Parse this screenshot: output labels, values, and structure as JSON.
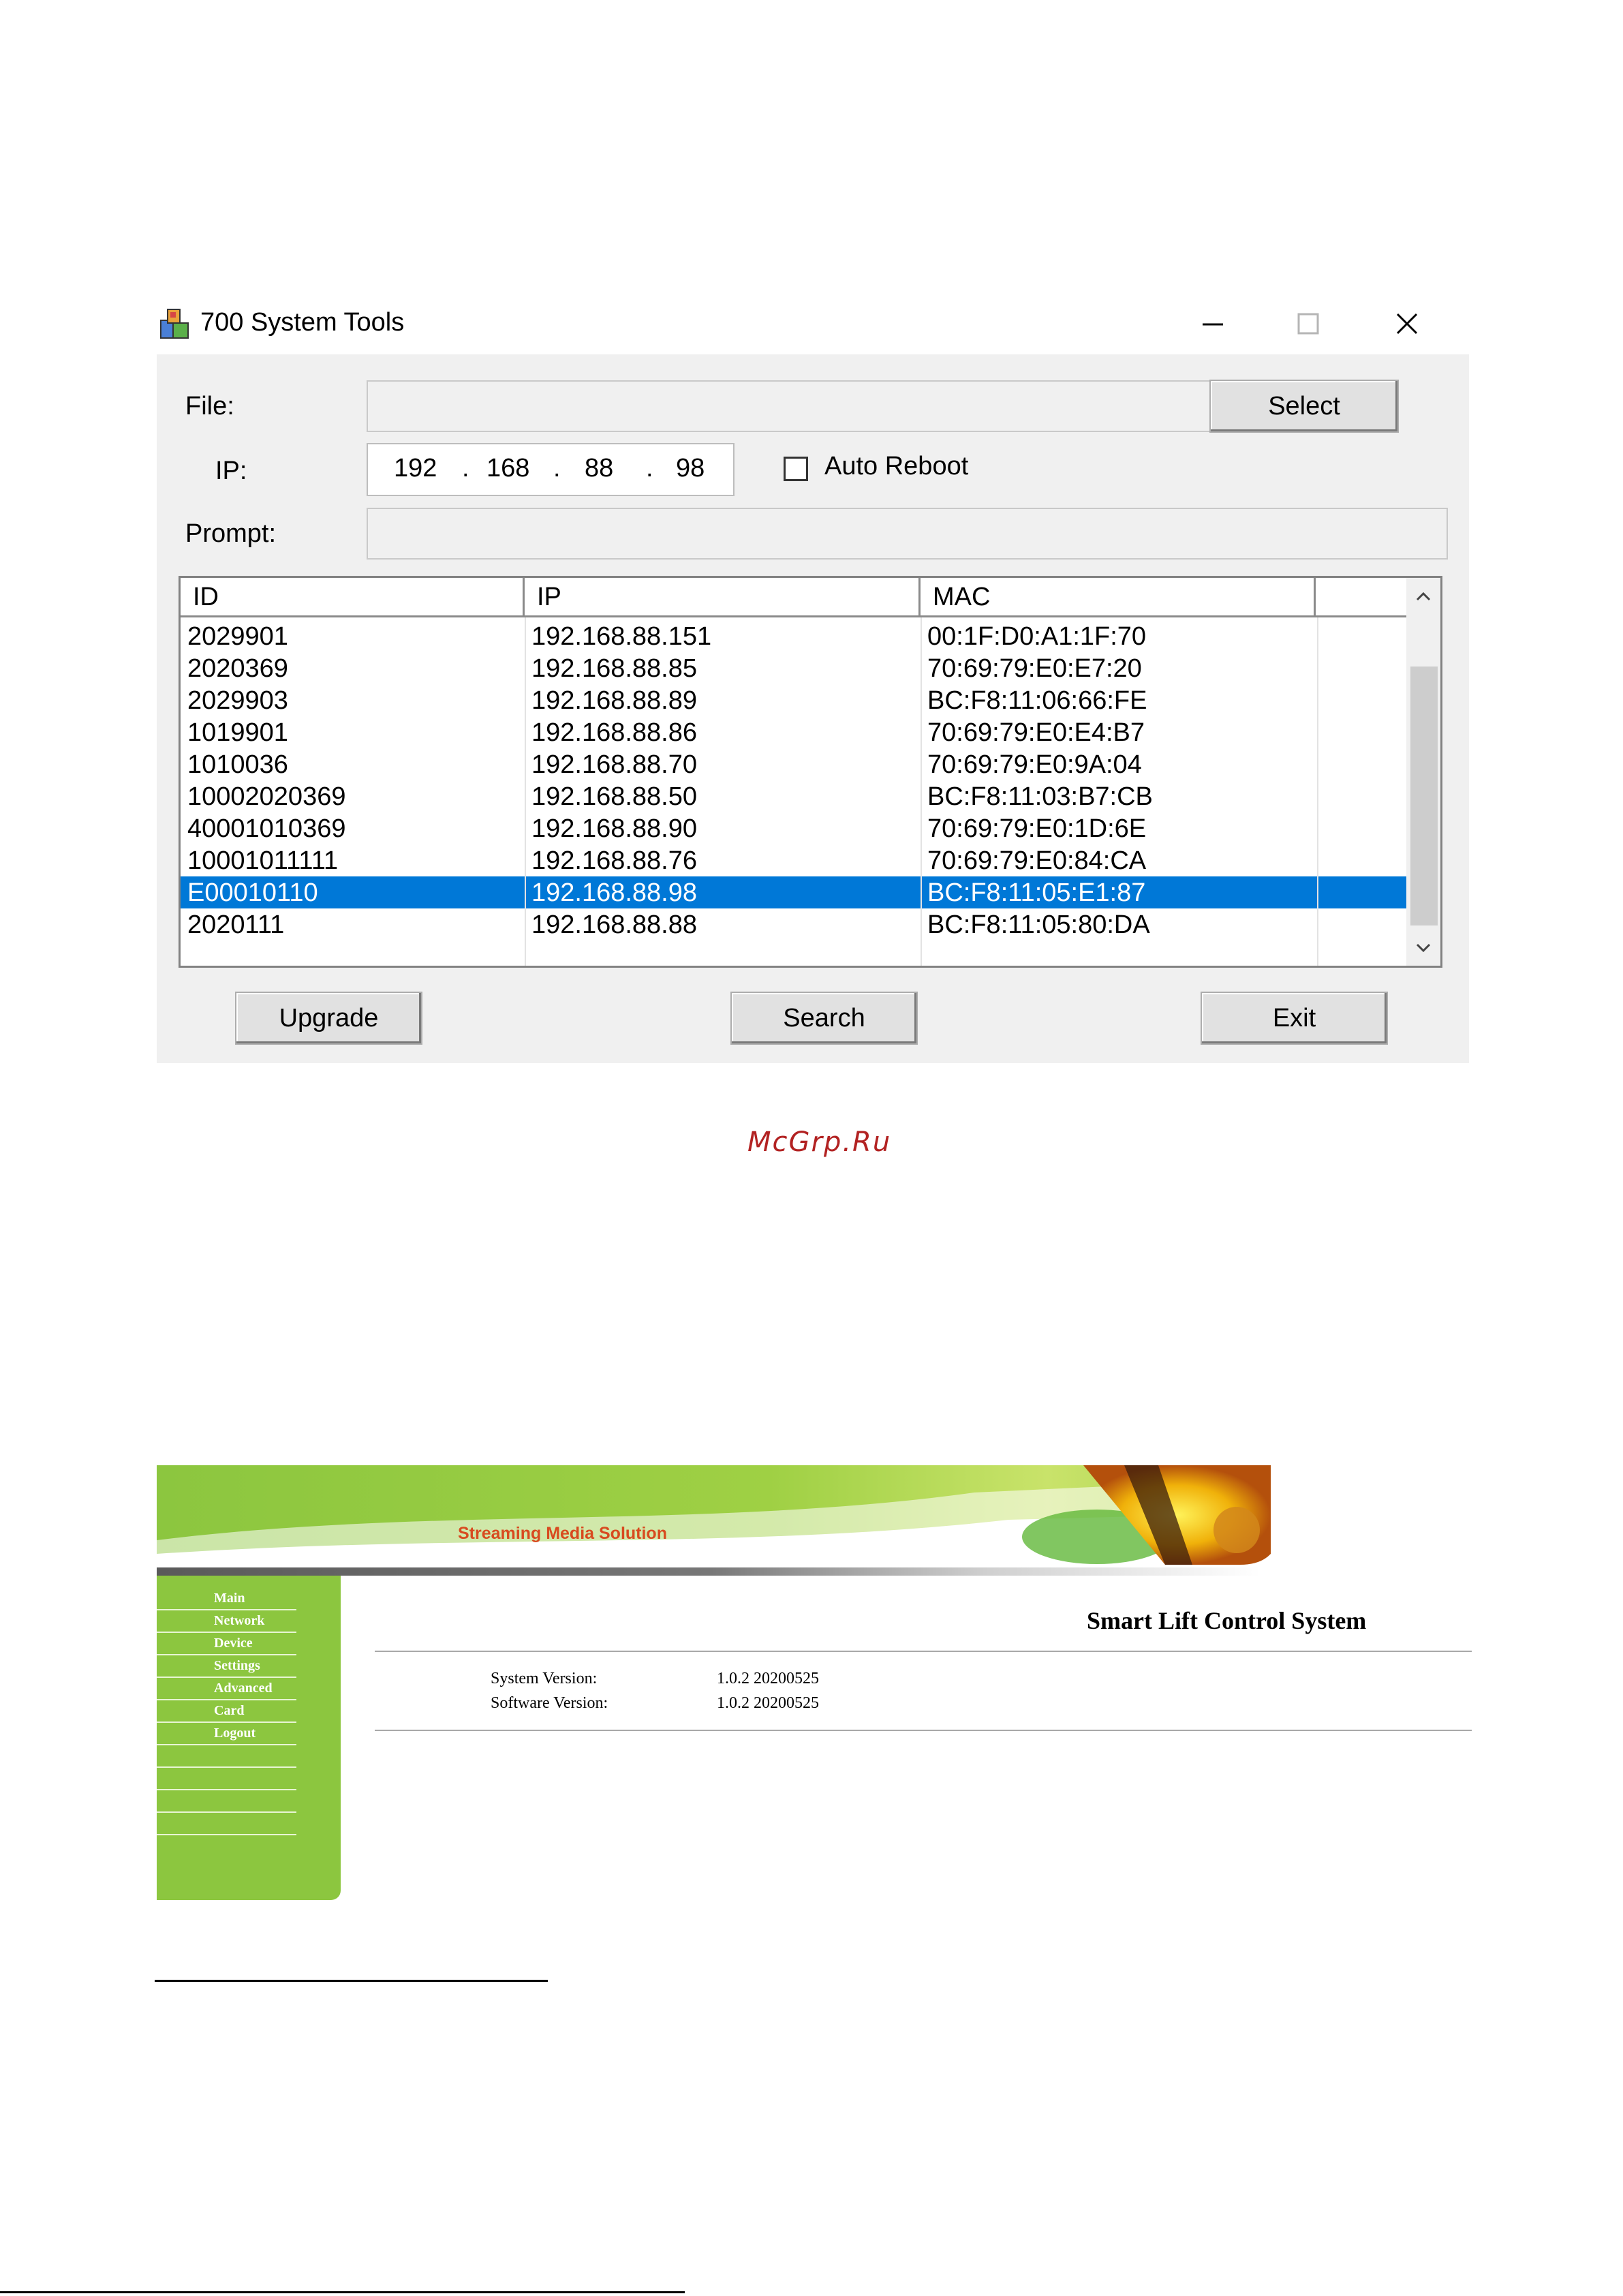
{
  "dialog": {
    "title": "700 System Tools",
    "labels": {
      "file": "File:",
      "ip": "IP:",
      "prompt": "Prompt:"
    },
    "file_value": "",
    "prompt_value": "",
    "ip_octets": [
      "192",
      "168",
      "88",
      "98"
    ],
    "auto_reboot": {
      "label": "Auto Reboot",
      "checked": false
    },
    "buttons": {
      "select": "Select",
      "upgrade": "Upgrade",
      "search": "Search",
      "exit": "Exit"
    },
    "table": {
      "columns": [
        "ID",
        "IP",
        "MAC"
      ],
      "selected_row": 8,
      "rows": [
        [
          "2029901",
          "192.168.88.151",
          "00:1F:D0:A1:1F:70"
        ],
        [
          "2020369",
          "192.168.88.85",
          "70:69:79:E0:E7:20"
        ],
        [
          "2029903",
          "192.168.88.89",
          "BC:F8:11:06:66:FE"
        ],
        [
          "1019901",
          "192.168.88.86",
          "70:69:79:E0:E4:B7"
        ],
        [
          "1010036",
          "192.168.88.70",
          "70:69:79:E0:9A:04"
        ],
        [
          "10002020369",
          "192.168.88.50",
          "BC:F8:11:03:B7:CB"
        ],
        [
          "40001010369",
          "192.168.88.90",
          "70:69:79:E0:1D:6E"
        ],
        [
          "10001011111",
          "192.168.88.76",
          "70:69:79:E0:84:CA"
        ],
        [
          "E00010110",
          "192.168.88.98",
          "BC:F8:11:05:E1:87"
        ],
        [
          "2020111",
          "192.168.88.88",
          "BC:F8:11:05:80:DA"
        ]
      ]
    },
    "colors": {
      "selection": "#0078d7",
      "window_bg": "#f0f0f0"
    }
  },
  "watermark": "McGrp.Ru",
  "web": {
    "banner_text": "Streaming Media Solution",
    "nav": [
      "Main",
      "Network",
      "Device",
      "Settings",
      "Advanced",
      "Card",
      "Logout"
    ],
    "page_title": "Smart Lift Control System",
    "info": [
      {
        "label": "System Version:",
        "value": "1.0.2 20200525"
      },
      {
        "label": "Software Version:",
        "value": "1.0.2 20200525"
      }
    ],
    "colors": {
      "sidebar": "#8cc63f",
      "banner_text": "#d84a1f"
    }
  }
}
